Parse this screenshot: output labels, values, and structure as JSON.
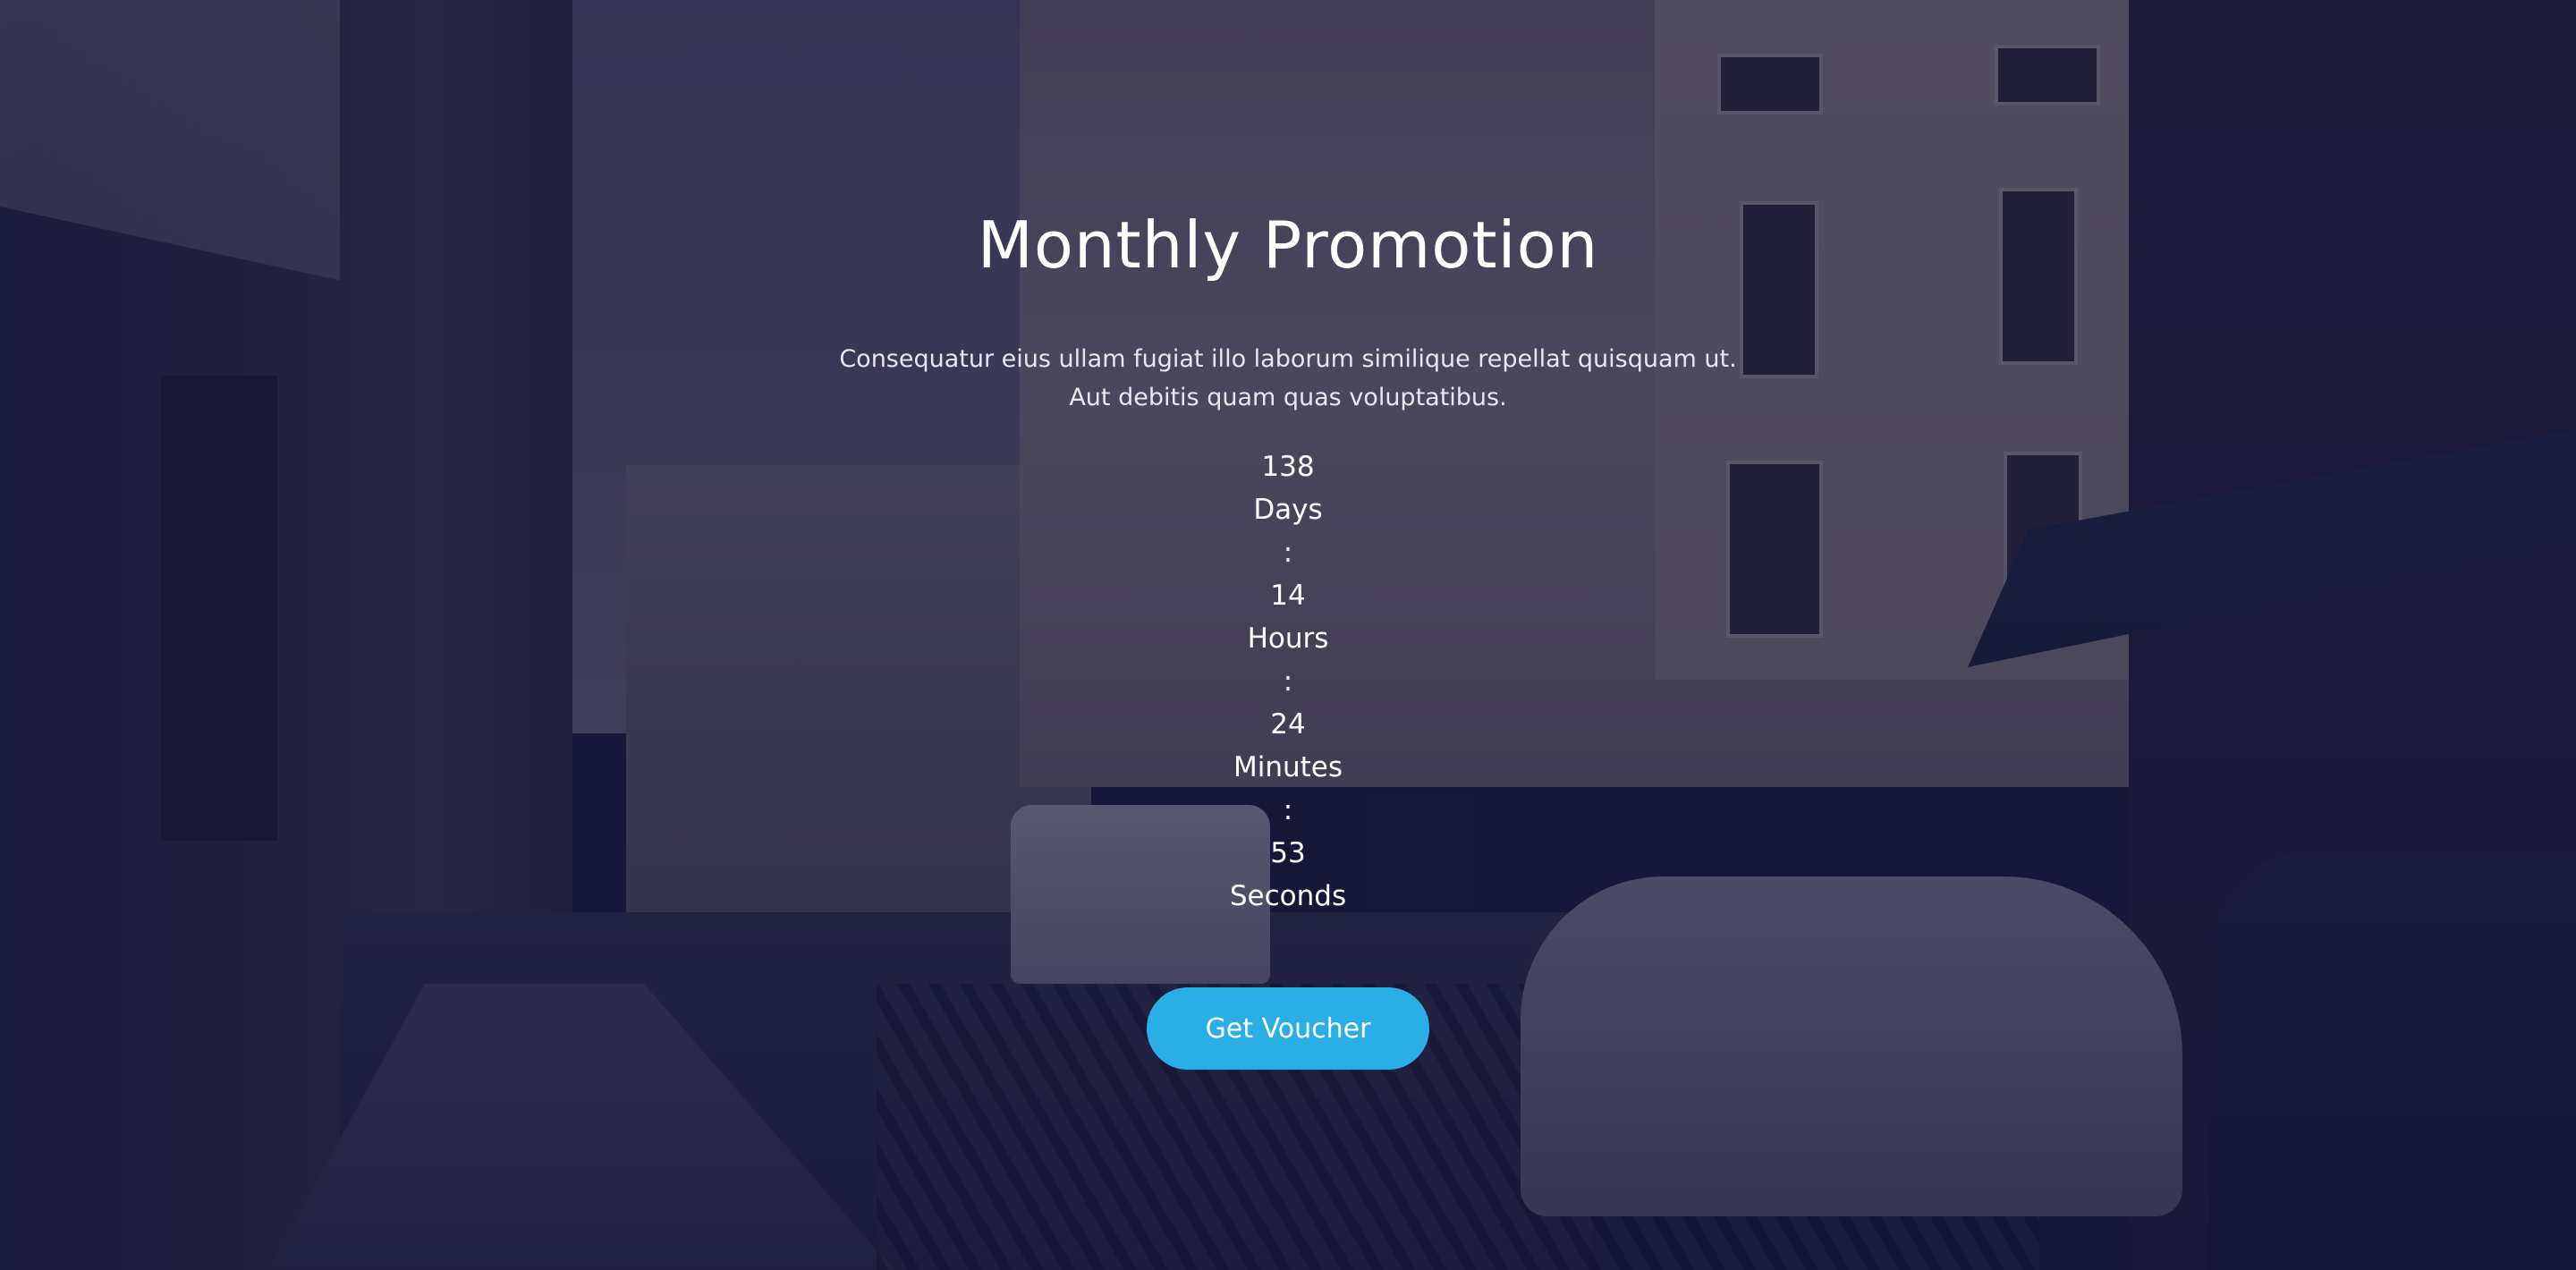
{
  "hero": {
    "title": "Monthly Promotion",
    "description_line1": "Consequatur eius ullam fugiat illo laborum similique repellat quisquam ut.",
    "description_line2": "Aut debitis quam quas voluptatibus."
  },
  "countdown": {
    "days_value": "138",
    "days_label": "Days",
    "sep1": ":",
    "hours_value": "14",
    "hours_label": "Hours",
    "sep2": ":",
    "minutes_value": "24",
    "minutes_label": "Minutes",
    "sep3": ":",
    "seconds_value": "53",
    "seconds_label": "Seconds"
  },
  "cta": {
    "label": "Get Voucher",
    "color": "#2aaee6"
  },
  "theme": {
    "overlay_color": "#141436"
  }
}
